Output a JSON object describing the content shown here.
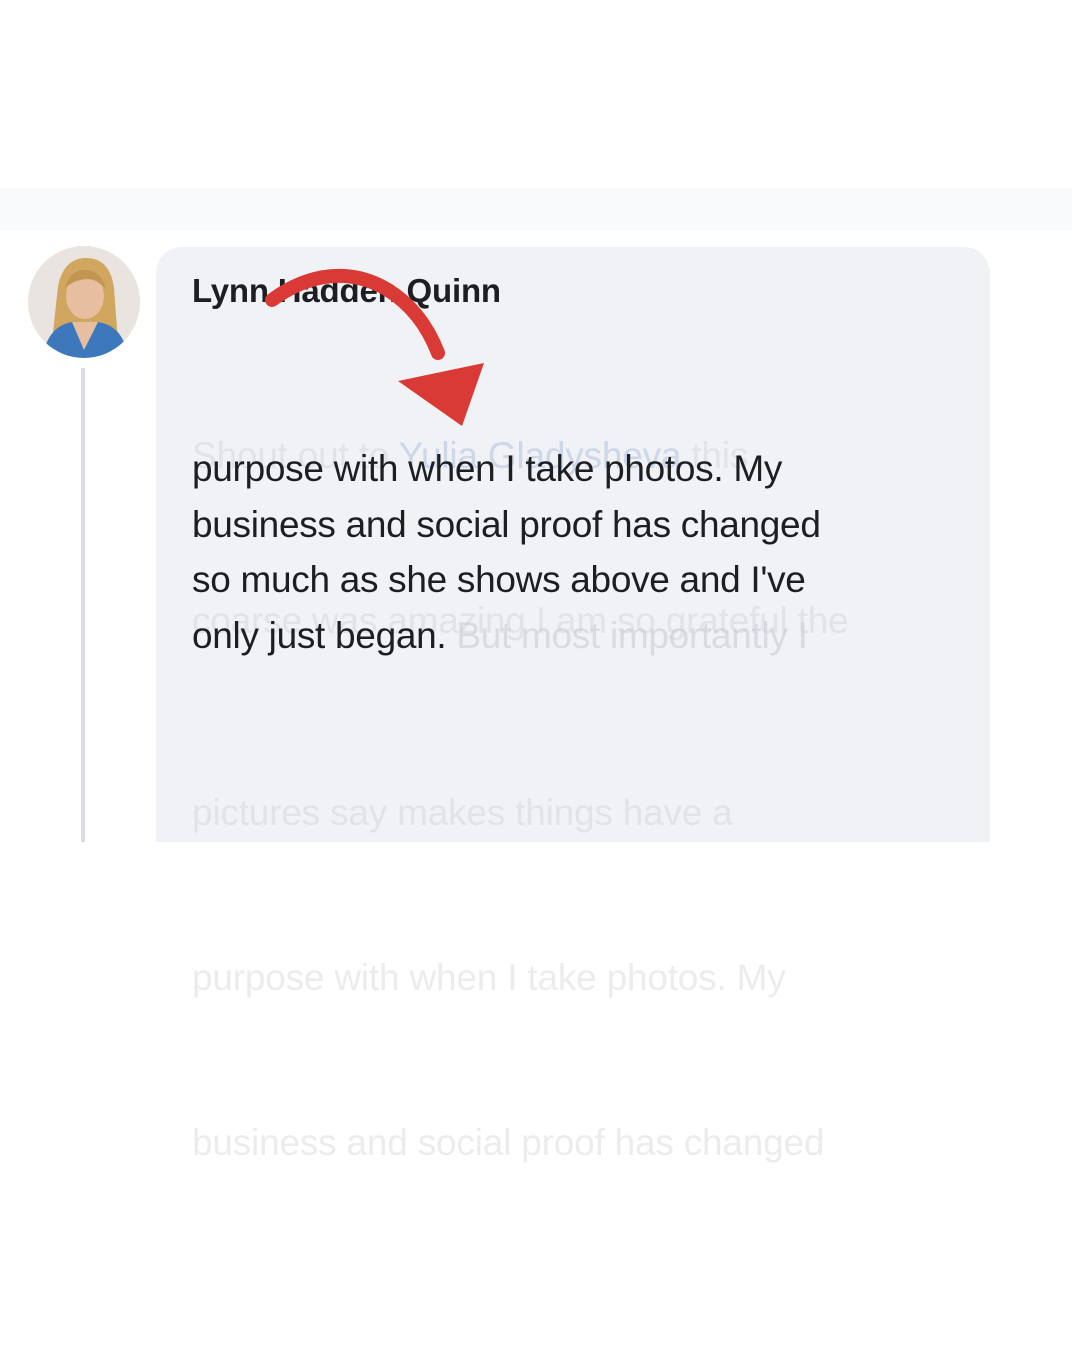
{
  "post": {
    "author_name": "Lynn Hadden Quinn",
    "faded_top_lines": [
      [
        "Shout out to ",
        "Yulia Gladysheva",
        " this"
      ],
      [
        "coarse was amazing I am so grateful the"
      ]
    ],
    "focus_lines": [
      "purpose with when I take photos. My",
      "business and social proof has changed",
      "so much as she shows above and I've"
    ],
    "focus_last_line": "only just began.",
    "focus_last_line_faded": " But most importantly I",
    "faded_bottom_lines": [
      "pictures say makes things have a",
      "purpose with when I take photos. My",
      "business and social proof has changed"
    ]
  },
  "colors": {
    "bubble_background": "#f0f2f5",
    "text": "#1c1e21",
    "arrow": "#d93a35",
    "thread_line": "#d9dce1"
  },
  "icons": {
    "avatar": "profile-photo",
    "annotation_arrow": "curved-arrow-icon"
  }
}
